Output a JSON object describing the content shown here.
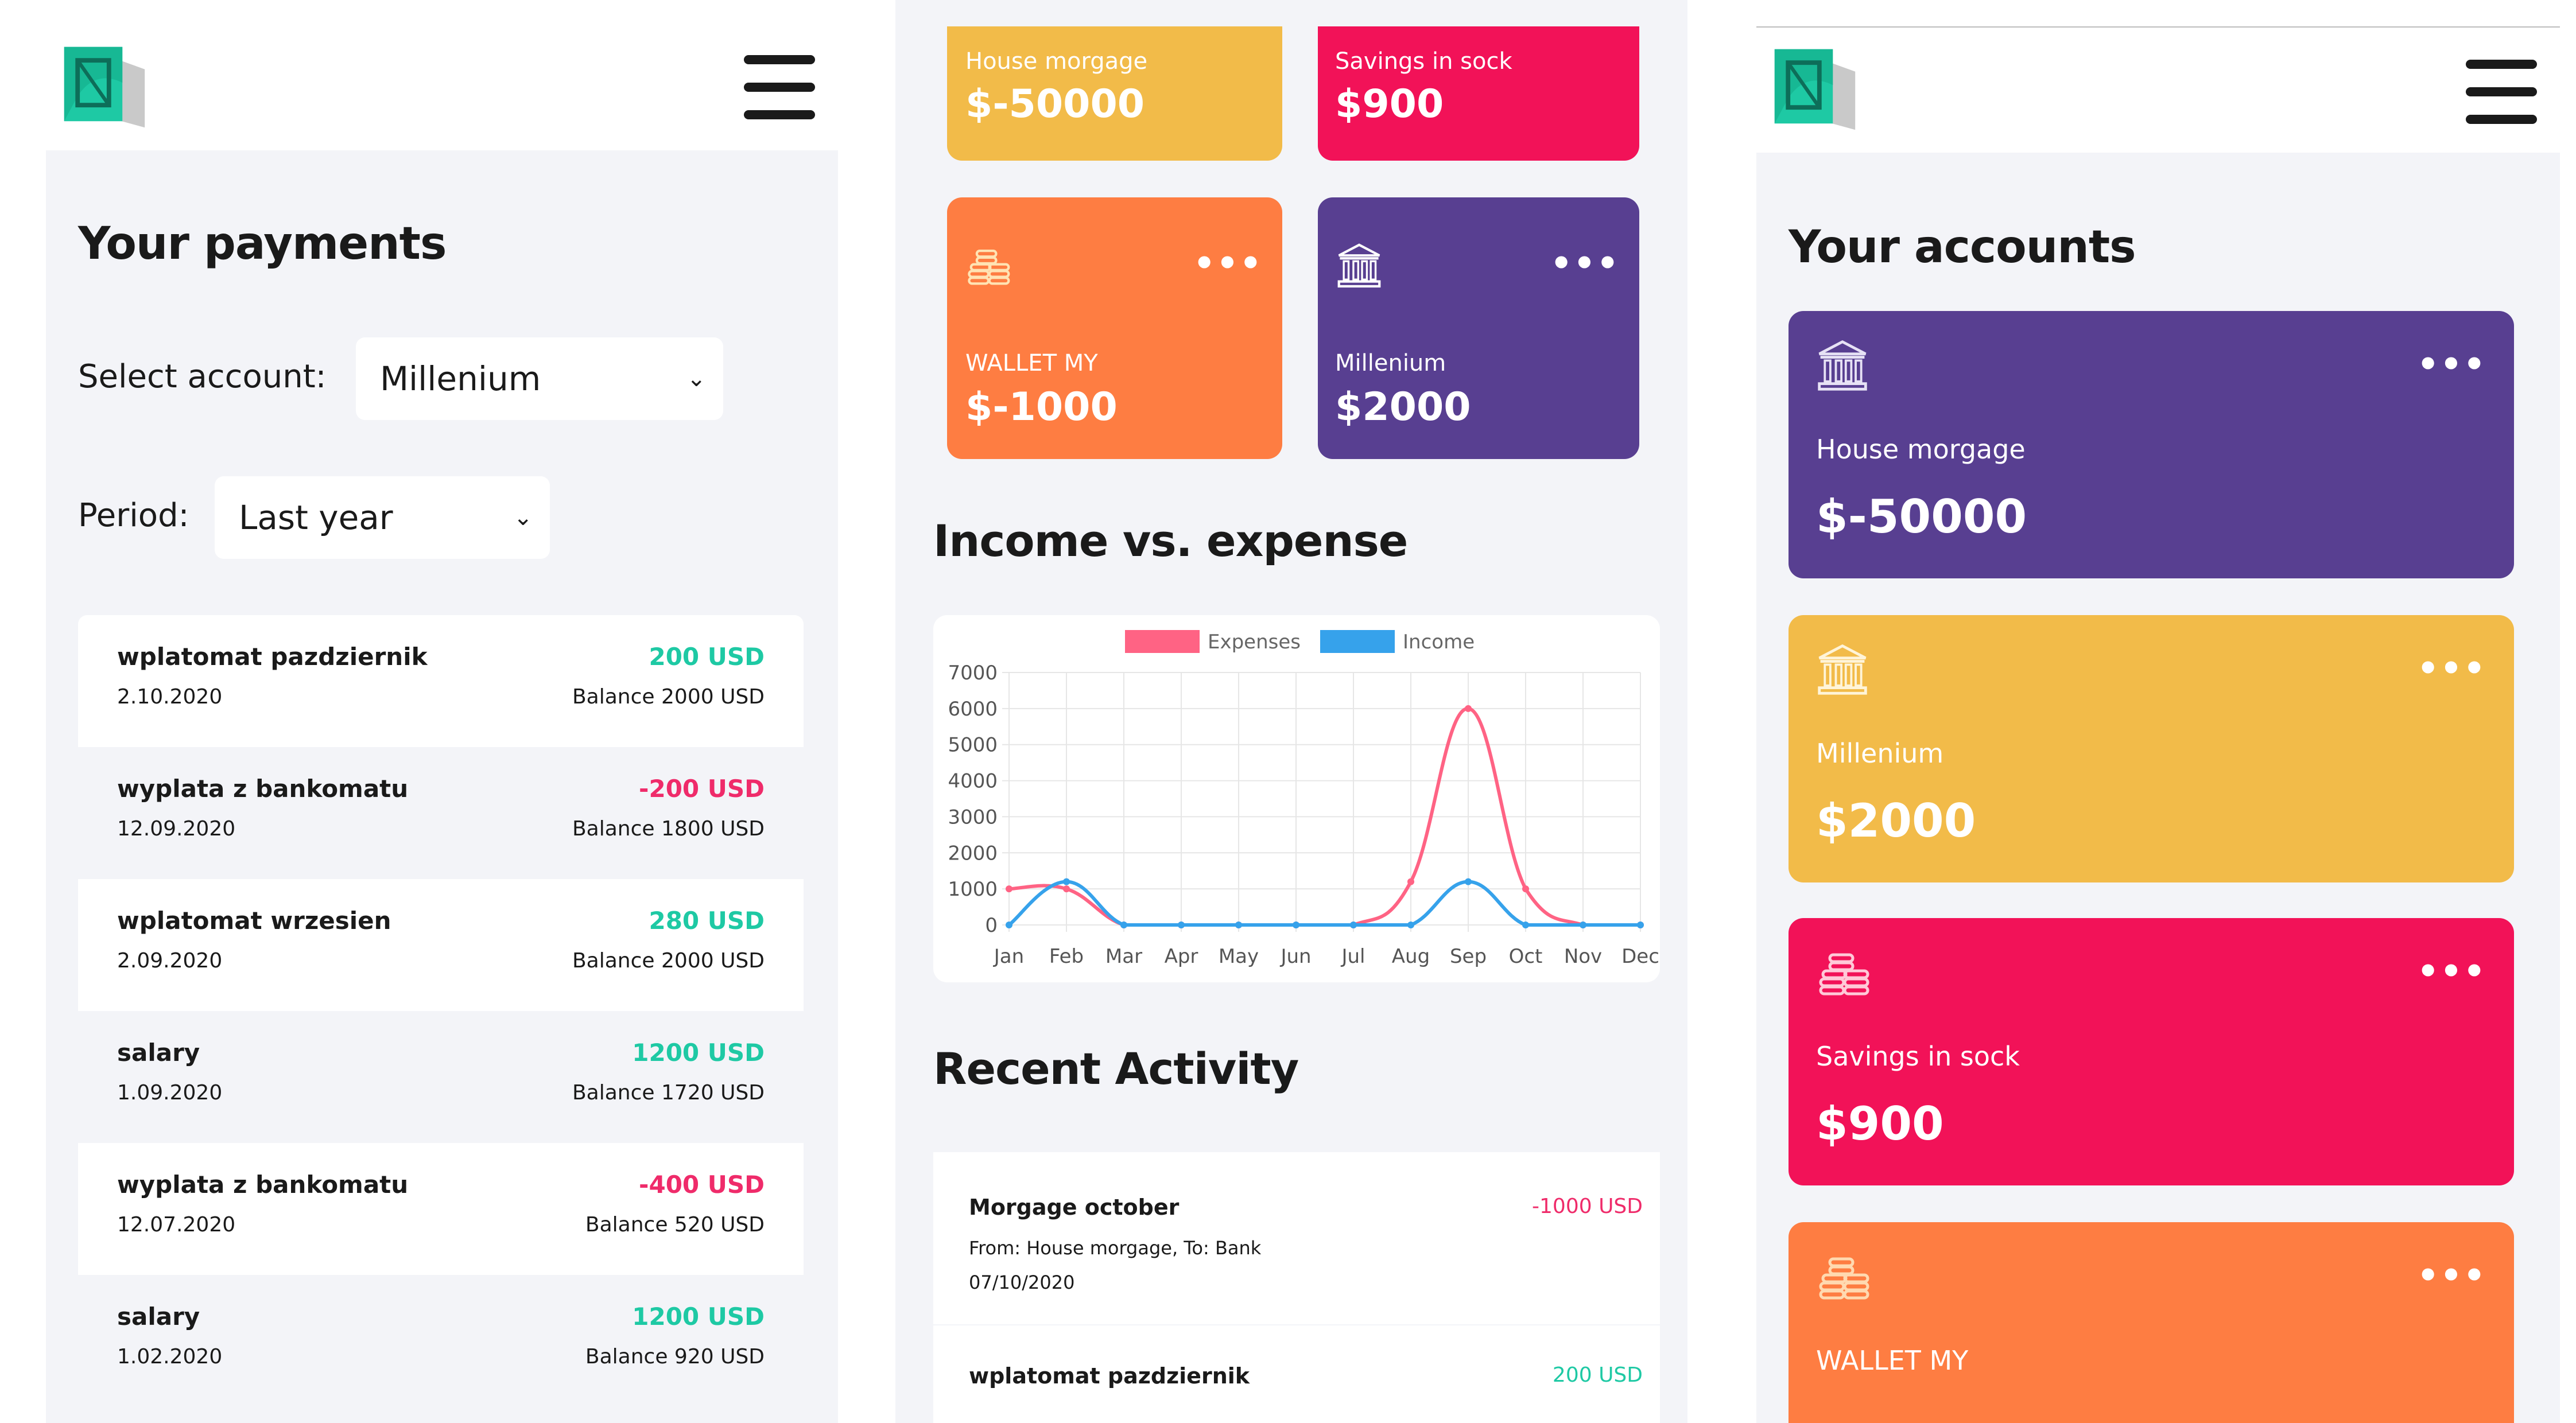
{
  "colors": {
    "yellow": "#f2bb49",
    "pink": "#f21258",
    "orange": "#fe7d42",
    "purple": "#583f91",
    "positive": "#1ec9a4",
    "negative": "#ef2b6a",
    "expenses_line": "#ff6384",
    "income_line": "#36a2eb"
  },
  "payments": {
    "title": "Your payments",
    "select_account_label": "Select account:",
    "account_value": "Millenium",
    "period_label": "Period:",
    "period_value": "Last year",
    "transactions": [
      {
        "name": "wplatomat pazdziernik",
        "date": "2.10.2020",
        "amount": "200 USD",
        "balance": "Balance 2000 USD",
        "sign": "positive"
      },
      {
        "name": "wyplata z bankomatu",
        "date": "12.09.2020",
        "amount": "-200 USD",
        "balance": "Balance 1800 USD",
        "sign": "negative"
      },
      {
        "name": "wplatomat wrzesien",
        "date": "2.09.2020",
        "amount": "280 USD",
        "balance": "Balance 2000 USD",
        "sign": "positive"
      },
      {
        "name": "salary",
        "date": "1.09.2020",
        "amount": "1200 USD",
        "balance": "Balance 1720 USD",
        "sign": "positive"
      },
      {
        "name": "wyplata z bankomatu",
        "date": "12.07.2020",
        "amount": "-400 USD",
        "balance": "Balance 520 USD",
        "sign": "negative"
      },
      {
        "name": "salary",
        "date": "1.02.2020",
        "amount": "1200 USD",
        "balance": "Balance 920 USD",
        "sign": "positive"
      }
    ]
  },
  "dashboard": {
    "cards": [
      {
        "name": "House morgage",
        "value": "$-50000",
        "color": "yellow",
        "icon": "none"
      },
      {
        "name": "Savings in sock",
        "value": "$900",
        "color": "pink",
        "icon": "none"
      },
      {
        "name": "WALLET MY",
        "value": "$-1000",
        "color": "orange",
        "icon": "coins-icon"
      },
      {
        "name": "Millenium",
        "value": "$2000",
        "color": "purple",
        "icon": "bank-icon"
      }
    ],
    "chart_title": "Income vs. expense",
    "activity_title": "Recent Activity",
    "activity": [
      {
        "name": "Morgage october",
        "details": "From: House morgage, To: Bank",
        "date": "07/10/2020",
        "amount": "-1000 USD",
        "sign": "negative"
      },
      {
        "name": "wplatomat pazdziernik",
        "amount": "200 USD",
        "sign": "positive"
      }
    ]
  },
  "chart_data": {
    "type": "line",
    "categories": [
      "Jan",
      "Feb",
      "Mar",
      "Apr",
      "May",
      "Jun",
      "Jul",
      "Aug",
      "Sep",
      "Oct",
      "Nov",
      "Dec"
    ],
    "series": [
      {
        "name": "Expenses",
        "values": [
          1000,
          1000,
          0,
          0,
          0,
          0,
          0,
          1200,
          6000,
          1000,
          0,
          0
        ]
      },
      {
        "name": "Income",
        "values": [
          0,
          1200,
          0,
          0,
          0,
          0,
          0,
          0,
          1200,
          0,
          0,
          0
        ]
      }
    ],
    "yticks": [
      "0",
      "1000",
      "2000",
      "3000",
      "4000",
      "5000",
      "6000",
      "7000"
    ],
    "ylim": [
      0,
      7000
    ],
    "grid": true,
    "legend": "top"
  },
  "accounts": {
    "title": "Your accounts",
    "cards": [
      {
        "name": "House morgage",
        "value": "$-50000",
        "color": "purple",
        "icon": "bank-icon"
      },
      {
        "name": "Millenium",
        "value": "$2000",
        "color": "yellow",
        "icon": "bank-icon"
      },
      {
        "name": "Savings in sock",
        "value": "$900",
        "color": "pink",
        "icon": "coins-icon"
      },
      {
        "name": "WALLET MY",
        "value": "",
        "color": "orange",
        "icon": "coins-icon"
      }
    ]
  },
  "ui": {
    "dots": "•••",
    "chevron": "⌄"
  }
}
